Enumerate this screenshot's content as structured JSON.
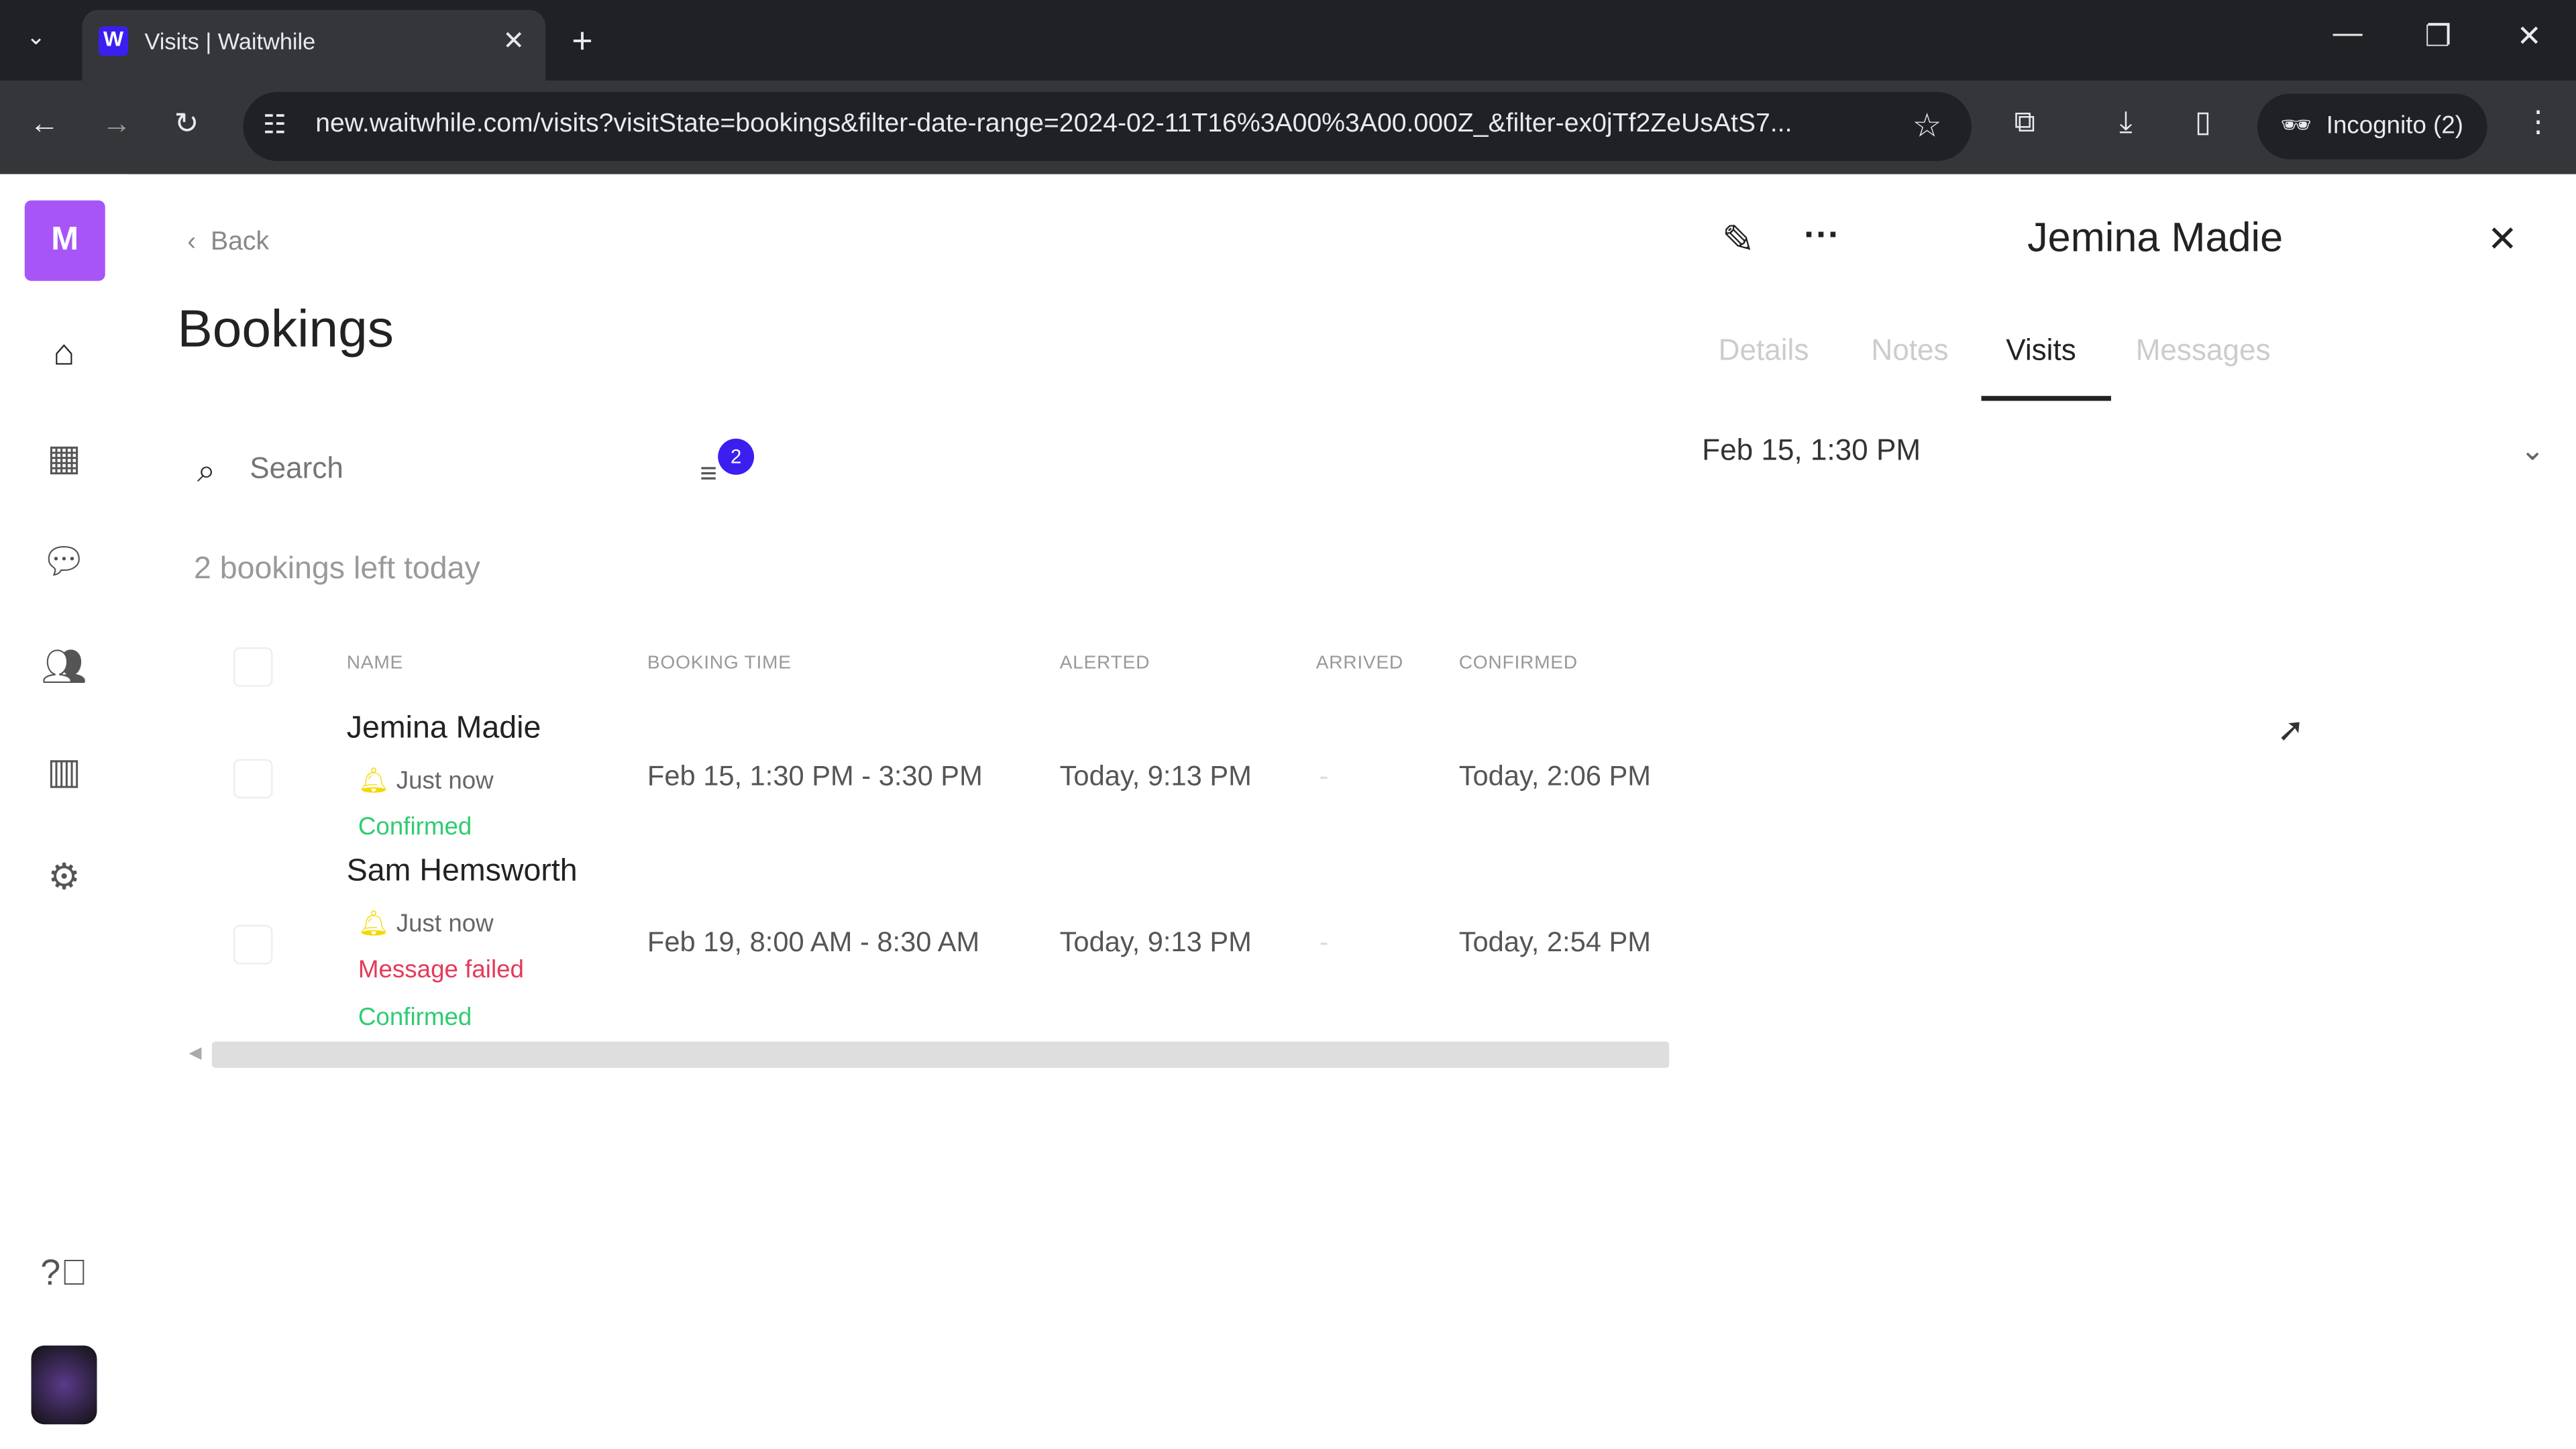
{
  "browser": {
    "tab_title": "Visits | Waitwhile",
    "url": "new.waitwhile.com/visits?visitState=bookings&filter-date-range=2024-02-11T16%3A00%3A00.000Z_&filter-ex0jTf2ZeUsAtS7...",
    "incognito": "Incognito (2)"
  },
  "sidebar": {
    "org_initial": "M",
    "items": [
      "home",
      "calendar",
      "messages",
      "customers",
      "analytics",
      "settings"
    ]
  },
  "main": {
    "back": "Back",
    "title": "Bookings",
    "search_placeholder": "Search",
    "filter_count": "2",
    "summary": "2 bookings left today",
    "columns": [
      "NAME",
      "BOOKING TIME",
      "ALERTED",
      "ARRIVED",
      "CONFIRMED"
    ],
    "rows": [
      {
        "name": "Jemina Madie",
        "alert": "Just now",
        "statuses": [
          "Confirmed"
        ],
        "booking_time": "Feb 15, 1:30 PM - 3:30 PM",
        "alerted": "Today, 9:13 PM",
        "arrived": "-",
        "confirmed": "Today, 2:06 PM"
      },
      {
        "name": "Sam Hemsworth",
        "alert": "Just now",
        "statuses": [
          "Message failed",
          "Confirmed"
        ],
        "booking_time": "Feb 19, 8:00 AM - 8:30 AM",
        "alerted": "Today, 9:13 PM",
        "arrived": "-",
        "confirmed": "Today, 2:54 PM"
      }
    ]
  },
  "panel": {
    "name": "Jemina Madie",
    "tabs": [
      "Details",
      "Notes",
      "Visits",
      "Messages"
    ],
    "active_tab": "Visits",
    "visit": "Feb 15, 1:30 PM"
  },
  "colors": {
    "accent": "#a855f7",
    "badge": "#3b1ff0",
    "confirmed": "#2ecc71",
    "failed": "#e53958"
  }
}
